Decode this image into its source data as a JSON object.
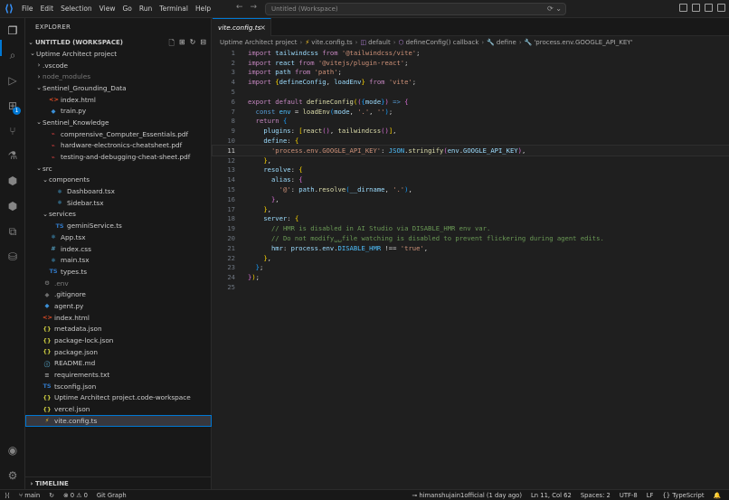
{
  "menu": [
    "File",
    "Edit",
    "Selection",
    "View",
    "Go",
    "Run",
    "Terminal",
    "Help"
  ],
  "command_center": {
    "label": "Untitled (Workspace)"
  },
  "colors": {
    "accent": "#0078d4",
    "background": "#1f1f1f",
    "sidebar": "#181818"
  },
  "activity_bar": {
    "items": [
      "explorer-icon",
      "search-icon",
      "run-debug-icon",
      "extensions-icon",
      "source-control-icon",
      "testing-icon",
      "python-icon",
      "python-icon",
      "remote-explorer-icon",
      "database-icon"
    ],
    "extensions_badge": "1",
    "bottom": [
      "account-icon",
      "settings-gear-icon"
    ]
  },
  "sidebar": {
    "title": "EXPLORER",
    "workspace": "UNTITLED (WORKSPACE)",
    "tree": [
      {
        "label": "Uptime Architect project",
        "depth": 0,
        "chevron": "v",
        "icon": "",
        "icon_color": ""
      },
      {
        "label": ".vscode",
        "depth": 1,
        "chevron": ">",
        "icon": "",
        "icon_color": ""
      },
      {
        "label": "node_modules",
        "depth": 1,
        "chevron": ">",
        "icon": "",
        "icon_color": "",
        "dim": true
      },
      {
        "label": "Sentinel_Grounding_Data",
        "depth": 1,
        "chevron": "v",
        "icon": "",
        "icon_color": ""
      },
      {
        "label": "index.html",
        "depth": 2,
        "chevron": "",
        "icon": "<>",
        "icon_color": "#e44d26"
      },
      {
        "label": "train.py",
        "depth": 2,
        "chevron": "",
        "icon": "◆",
        "icon_color": "#3b8fd6"
      },
      {
        "label": "Sentinel_Knowledge",
        "depth": 1,
        "chevron": "v",
        "icon": "",
        "icon_color": ""
      },
      {
        "label": "comprensive_Computer_Essentials.pdf",
        "depth": 2,
        "chevron": "",
        "icon": "⌁",
        "icon_color": "#e04141"
      },
      {
        "label": "hardware-electronics-cheatsheet.pdf",
        "depth": 2,
        "chevron": "",
        "icon": "⌁",
        "icon_color": "#e04141"
      },
      {
        "label": "testing-and-debugging-cheat-sheet.pdf",
        "depth": 2,
        "chevron": "",
        "icon": "⌁",
        "icon_color": "#e04141"
      },
      {
        "label": "src",
        "depth": 1,
        "chevron": "v",
        "icon": "",
        "icon_color": ""
      },
      {
        "label": "components",
        "depth": 2,
        "chevron": "v",
        "icon": "",
        "icon_color": ""
      },
      {
        "label": "Dashboard.tsx",
        "depth": 3,
        "chevron": "",
        "icon": "⚛",
        "icon_color": "#4fc1ff"
      },
      {
        "label": "Sidebar.tsx",
        "depth": 3,
        "chevron": "",
        "icon": "⚛",
        "icon_color": "#4fc1ff"
      },
      {
        "label": "services",
        "depth": 2,
        "chevron": "v",
        "icon": "",
        "icon_color": ""
      },
      {
        "label": "geminiService.ts",
        "depth": 3,
        "chevron": "",
        "icon": "TS",
        "icon_color": "#3178c6"
      },
      {
        "label": "App.tsx",
        "depth": 2,
        "chevron": "",
        "icon": "⚛",
        "icon_color": "#4fc1ff"
      },
      {
        "label": "index.css",
        "depth": 2,
        "chevron": "",
        "icon": "#",
        "icon_color": "#519aba"
      },
      {
        "label": "main.tsx",
        "depth": 2,
        "chevron": "",
        "icon": "⚛",
        "icon_color": "#4fc1ff"
      },
      {
        "label": "types.ts",
        "depth": 2,
        "chevron": "",
        "icon": "TS",
        "icon_color": "#3178c6"
      },
      {
        "label": ".env",
        "depth": 1,
        "chevron": "",
        "icon": "⚙",
        "icon_color": "#8a8a8a",
        "dim": true
      },
      {
        "label": ".gitignore",
        "depth": 1,
        "chevron": "",
        "icon": "◆",
        "icon_color": "#6d6d6d"
      },
      {
        "label": "agent.py",
        "depth": 1,
        "chevron": "",
        "icon": "◆",
        "icon_color": "#3b8fd6"
      },
      {
        "label": "index.html",
        "depth": 1,
        "chevron": "",
        "icon": "<>",
        "icon_color": "#e44d26"
      },
      {
        "label": "metadata.json",
        "depth": 1,
        "chevron": "",
        "icon": "{}",
        "icon_color": "#cbcb41"
      },
      {
        "label": "package-lock.json",
        "depth": 1,
        "chevron": "",
        "icon": "{}",
        "icon_color": "#cbcb41"
      },
      {
        "label": "package.json",
        "depth": 1,
        "chevron": "",
        "icon": "{}",
        "icon_color": "#cbcb41"
      },
      {
        "label": "README.md",
        "depth": 1,
        "chevron": "",
        "icon": "ⓘ",
        "icon_color": "#519aba"
      },
      {
        "label": "requirements.txt",
        "depth": 1,
        "chevron": "",
        "icon": "≡",
        "icon_color": "#a0a0a0"
      },
      {
        "label": "tsconfig.json",
        "depth": 1,
        "chevron": "",
        "icon": "TS",
        "icon_color": "#3178c6"
      },
      {
        "label": "Uptime Architect project.code-workspace",
        "depth": 1,
        "chevron": "",
        "icon": "{}",
        "icon_color": "#cbcb41"
      },
      {
        "label": "vercel.json",
        "depth": 1,
        "chevron": "",
        "icon": "{}",
        "icon_color": "#cbcb41"
      },
      {
        "label": "vite.config.ts",
        "depth": 1,
        "chevron": "",
        "icon": "⚡",
        "icon_color": "#ffca28",
        "selected": true
      }
    ],
    "timeline": "TIMELINE"
  },
  "editor": {
    "tab": {
      "label": "vite.config.ts"
    },
    "breadcrumb": [
      "Uptime Architect project",
      "vite.config.ts",
      "default",
      "defineConfig() callback",
      "define",
      "'process.env.GOOGLE_API_KEY'"
    ],
    "current_line": 11,
    "lines": [
      [
        [
          "kw",
          "import"
        ],
        [
          "pn",
          " "
        ],
        [
          "vr",
          "tailwindcss"
        ],
        [
          "pn",
          " "
        ],
        [
          "kw",
          "from"
        ],
        [
          "pn",
          " "
        ],
        [
          "st",
          "'@tailwindcss/vite'"
        ],
        [
          "pn",
          ";"
        ]
      ],
      [
        [
          "kw",
          "import"
        ],
        [
          "pn",
          " "
        ],
        [
          "vr",
          "react"
        ],
        [
          "pn",
          " "
        ],
        [
          "kw",
          "from"
        ],
        [
          "pn",
          " "
        ],
        [
          "st",
          "'@vitejs/plugin-react'"
        ],
        [
          "pn",
          ";"
        ]
      ],
      [
        [
          "kw",
          "import"
        ],
        [
          "pn",
          " "
        ],
        [
          "vr",
          "path"
        ],
        [
          "pn",
          " "
        ],
        [
          "kw",
          "from"
        ],
        [
          "pn",
          " "
        ],
        [
          "st",
          "'path'"
        ],
        [
          "pn",
          ";"
        ]
      ],
      [
        [
          "kw",
          "import"
        ],
        [
          "pn",
          " "
        ],
        [
          "br1",
          "{"
        ],
        [
          "vr",
          "defineConfig"
        ],
        [
          "pn",
          ", "
        ],
        [
          "vr",
          "loadEnv"
        ],
        [
          "br1",
          "}"
        ],
        [
          "pn",
          " "
        ],
        [
          "kw",
          "from"
        ],
        [
          "pn",
          " "
        ],
        [
          "st",
          "'vite'"
        ],
        [
          "pn",
          ";"
        ]
      ],
      [],
      [
        [
          "kw",
          "export"
        ],
        [
          "pn",
          " "
        ],
        [
          "kw",
          "default"
        ],
        [
          "pn",
          " "
        ],
        [
          "fn",
          "defineConfig"
        ],
        [
          "br1",
          "("
        ],
        [
          "br2",
          "("
        ],
        [
          "br3",
          "{"
        ],
        [
          "vr",
          "mode"
        ],
        [
          "br3",
          "}"
        ],
        [
          "br2",
          ")"
        ],
        [
          "pn",
          " "
        ],
        [
          "kb",
          "=>"
        ],
        [
          "pn",
          " "
        ],
        [
          "br2",
          "{"
        ]
      ],
      [
        [
          "pn",
          "  "
        ],
        [
          "kb",
          "const"
        ],
        [
          "pn",
          " "
        ],
        [
          "cn",
          "env"
        ],
        [
          "pn",
          " = "
        ],
        [
          "fn",
          "loadEnv"
        ],
        [
          "br3",
          "("
        ],
        [
          "vr",
          "mode"
        ],
        [
          "pn",
          ", "
        ],
        [
          "st",
          "'.'"
        ],
        [
          "pn",
          ", "
        ],
        [
          "st",
          "''"
        ],
        [
          "br3",
          ")"
        ],
        [
          "pn",
          ";"
        ]
      ],
      [
        [
          "pn",
          "  "
        ],
        [
          "kw",
          "return"
        ],
        [
          "pn",
          " "
        ],
        [
          "br3",
          "{"
        ]
      ],
      [
        [
          "pn",
          "    "
        ],
        [
          "vr",
          "plugins"
        ],
        [
          "pn",
          ": "
        ],
        [
          "br1",
          "["
        ],
        [
          "fn",
          "react"
        ],
        [
          "br2",
          "()"
        ],
        [
          "pn",
          ", "
        ],
        [
          "fn",
          "tailwindcss"
        ],
        [
          "br2",
          "()"
        ],
        [
          "br1",
          "]"
        ],
        [
          "pn",
          ","
        ]
      ],
      [
        [
          "pn",
          "    "
        ],
        [
          "vr",
          "define"
        ],
        [
          "pn",
          ": "
        ],
        [
          "br1",
          "{"
        ]
      ],
      [
        [
          "pn",
          "      "
        ],
        [
          "st",
          "'process.env.GOOGLE_API_KEY'"
        ],
        [
          "pn",
          ": "
        ],
        [
          "cn",
          "JSON"
        ],
        [
          "pn",
          "."
        ],
        [
          "fn",
          "stringify"
        ],
        [
          "br2",
          "("
        ],
        [
          "vr",
          "env"
        ],
        [
          "pn",
          "."
        ],
        [
          "vr",
          "GOOGLE_API_KEY"
        ],
        [
          "br2",
          ")"
        ],
        [
          "pn",
          ","
        ]
      ],
      [
        [
          "pn",
          "    "
        ],
        [
          "br1",
          "}"
        ],
        [
          "pn",
          ","
        ]
      ],
      [
        [
          "pn",
          "    "
        ],
        [
          "vr",
          "resolve"
        ],
        [
          "pn",
          ": "
        ],
        [
          "br1",
          "{"
        ]
      ],
      [
        [
          "pn",
          "      "
        ],
        [
          "vr",
          "alias"
        ],
        [
          "pn",
          ": "
        ],
        [
          "br2",
          "{"
        ]
      ],
      [
        [
          "pn",
          "        "
        ],
        [
          "st",
          "'@'"
        ],
        [
          "pn",
          ": "
        ],
        [
          "vr",
          "path"
        ],
        [
          "pn",
          "."
        ],
        [
          "fn",
          "resolve"
        ],
        [
          "br3",
          "("
        ],
        [
          "vr",
          "__dirname"
        ],
        [
          "pn",
          ", "
        ],
        [
          "st",
          "'.'"
        ],
        [
          "br3",
          ")"
        ],
        [
          "pn",
          ","
        ]
      ],
      [
        [
          "pn",
          "      "
        ],
        [
          "br2",
          "}"
        ],
        [
          "pn",
          ","
        ]
      ],
      [
        [
          "pn",
          "    "
        ],
        [
          "br1",
          "}"
        ],
        [
          "pn",
          ","
        ]
      ],
      [
        [
          "pn",
          "    "
        ],
        [
          "vr",
          "server"
        ],
        [
          "pn",
          ": "
        ],
        [
          "br1",
          "{"
        ]
      ],
      [
        [
          "pn",
          "      "
        ],
        [
          "cm",
          "// HMR is disabled in AI Studio via DISABLE_HMR env var."
        ]
      ],
      [
        [
          "pn",
          "      "
        ],
        [
          "cm",
          "// Do not modify␣␣file watching is disabled to prevent flickering during agent edits."
        ]
      ],
      [
        [
          "pn",
          "      "
        ],
        [
          "vr",
          "hmr"
        ],
        [
          "pn",
          ": "
        ],
        [
          "vr",
          "process"
        ],
        [
          "pn",
          "."
        ],
        [
          "vr",
          "env"
        ],
        [
          "pn",
          "."
        ],
        [
          "cn",
          "DISABLE_HMR"
        ],
        [
          "pn",
          " "
        ],
        [
          "pn",
          "!=="
        ],
        [
          "pn",
          " "
        ],
        [
          "st",
          "'true'"
        ],
        [
          "pn",
          ","
        ]
      ],
      [
        [
          "pn",
          "    "
        ],
        [
          "br1",
          "}"
        ],
        [
          "pn",
          ","
        ]
      ],
      [
        [
          "pn",
          "  "
        ],
        [
          "br3",
          "}"
        ],
        [
          "pn",
          ";"
        ]
      ],
      [
        [
          "br2",
          "}"
        ],
        [
          "br1",
          ")"
        ],
        [
          "pn",
          ";"
        ]
      ],
      []
    ]
  },
  "status": {
    "branch": "main",
    "errors": "0",
    "warnings": "0",
    "git_graph": "Git Graph",
    "blame": "himanshujain1official (1 day ago)",
    "position": "Ln 11, Col 62",
    "spaces": "Spaces: 2",
    "encoding": "UTF-8",
    "eol": "LF",
    "language": "TypeScript"
  }
}
